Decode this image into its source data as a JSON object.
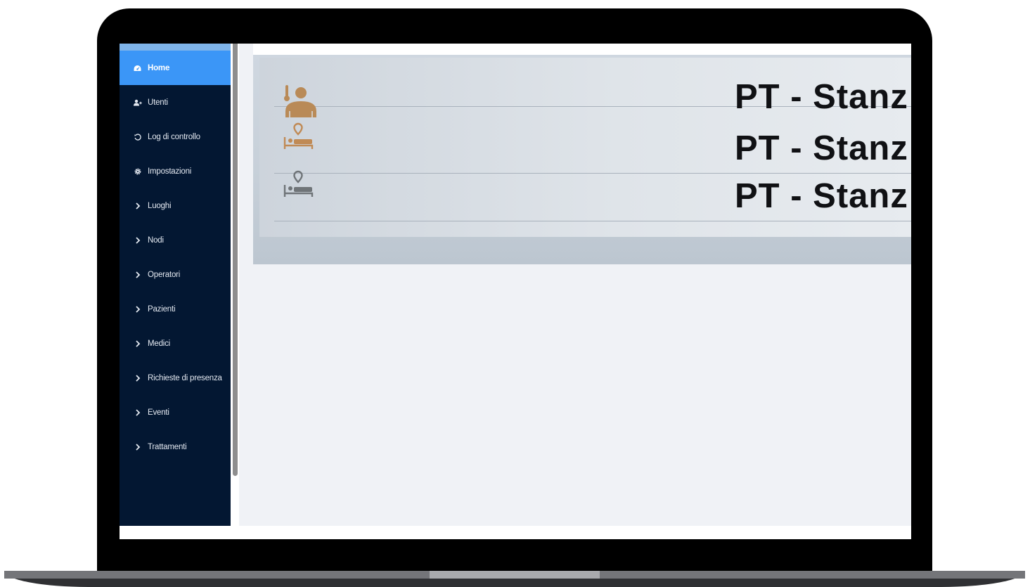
{
  "sidebar": {
    "items": [
      {
        "label": "Home",
        "icon": "dashboard-icon",
        "active": true
      },
      {
        "label": "Utenti",
        "icon": "users-icon",
        "active": false
      },
      {
        "label": "Log di controllo",
        "icon": "history-icon",
        "active": false
      },
      {
        "label": "Impostazioni",
        "icon": "gear-icon",
        "active": false
      },
      {
        "label": "Luoghi",
        "icon": "chevron-right-icon",
        "active": false
      },
      {
        "label": "Nodi",
        "icon": "chevron-right-icon",
        "active": false
      },
      {
        "label": "Operatori",
        "icon": "chevron-right-icon",
        "active": false
      },
      {
        "label": "Pazienti",
        "icon": "chevron-right-icon",
        "active": false
      },
      {
        "label": "Medici",
        "icon": "chevron-right-icon",
        "active": false
      },
      {
        "label": "Richieste di presenza",
        "icon": "chevron-right-icon",
        "active": false
      },
      {
        "label": "Eventi",
        "icon": "chevron-right-icon",
        "active": false
      },
      {
        "label": "Trattamenti",
        "icon": "chevron-right-icon",
        "active": false
      }
    ]
  },
  "rooms": [
    {
      "label": "PT - Stanz",
      "icon": "patient-temperature-icon",
      "icon_color": "#b98a57"
    },
    {
      "label": "PT - Stanz",
      "icon": "bed-location-icon",
      "icon_color": "#c08a55"
    },
    {
      "label": "PT - Stanz",
      "icon": "bed-location-icon",
      "icon_color": "#6f7478"
    }
  ],
  "colors": {
    "sidebar_bg": "#031732",
    "active_item": "#3b96f7",
    "main_bg": "#f0f2f6"
  }
}
